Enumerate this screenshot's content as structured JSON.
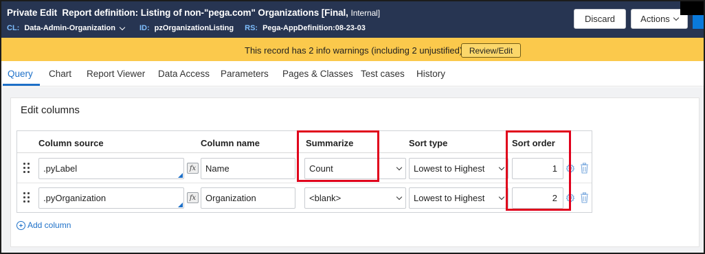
{
  "header": {
    "title_prefix": "Private Edit",
    "title_main": "Report definition: Listing of non-\"pega.com\" Organizations [Final,",
    "title_status": "Internal]",
    "class_key": "CL:",
    "class_value": "Data-Admin-Organization",
    "id_key": "ID:",
    "id_value": "pzOrganizationListing",
    "rs_key": "RS:",
    "rs_value": "Pega-AppDefinition:08-23-03",
    "discard_label": "Discard",
    "actions_label": "Actions",
    "accent_color": "#273552"
  },
  "warning": {
    "text": "This record has 2 info warnings (including 2 unjustified)",
    "button_label": "Review/Edit",
    "color": "#fbc94c"
  },
  "tabs": [
    {
      "label": "Query",
      "active": true
    },
    {
      "label": "Chart"
    },
    {
      "label": "Report Viewer"
    },
    {
      "label": "Data Access"
    },
    {
      "label": "Parameters"
    },
    {
      "label": "Pages & Classes"
    },
    {
      "label": "Test cases"
    },
    {
      "label": "History"
    }
  ],
  "edit_columns": {
    "title": "Edit columns",
    "headers": {
      "source": "Column source",
      "name": "Column name",
      "summarize": "Summarize",
      "sort_type": "Sort type",
      "sort_order": "Sort order"
    },
    "rows": [
      {
        "source": ".pyLabel",
        "name": "Name",
        "summarize": "Count",
        "sort_type": "Lowest to Highest",
        "sort_order": "1"
      },
      {
        "source": ".pyOrganization",
        "name": "Organization",
        "summarize": "<blank>",
        "sort_type": "Lowest to Highest",
        "sort_order": "2"
      }
    ],
    "add_column_label": "Add column",
    "fx_label": "fx"
  },
  "highlight_color": "#e0001b"
}
